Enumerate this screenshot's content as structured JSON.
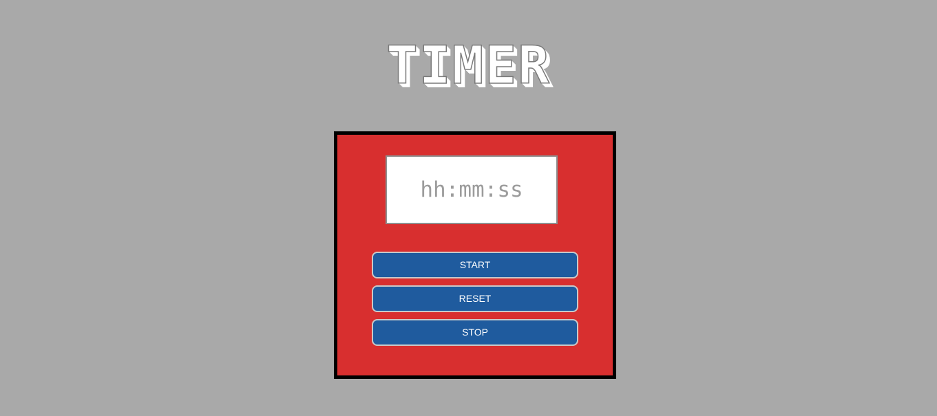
{
  "header": {
    "title": "TIMER"
  },
  "timer": {
    "input_value": "",
    "input_placeholder": "hh:mm:ss"
  },
  "controls": {
    "start_label": "START",
    "reset_label": "RESET",
    "stop_label": "STOP"
  },
  "colors": {
    "background": "#a9a9a9",
    "panel": "#d82f2f",
    "panel_border": "#000000",
    "button": "#1f5b9e",
    "button_text": "#ffffff",
    "title": "#ffffff"
  }
}
